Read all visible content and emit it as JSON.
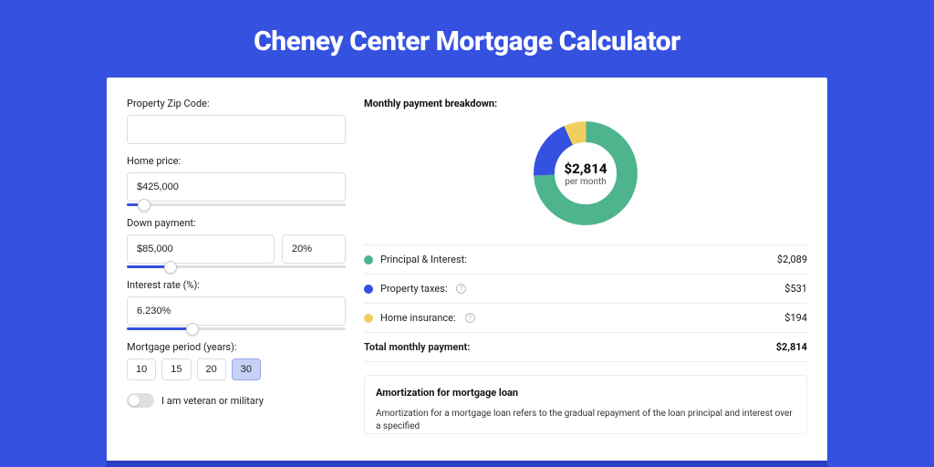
{
  "title": "Cheney Center Mortgage Calculator",
  "form": {
    "zip": {
      "label": "Property Zip Code:",
      "value": ""
    },
    "home_price": {
      "label": "Home price:",
      "value": "$425,000",
      "slider_percent": 8
    },
    "down_payment": {
      "label": "Down payment:",
      "value": "$85,000",
      "percent": "20%",
      "slider_percent": 20
    },
    "interest_rate": {
      "label": "Interest rate (%):",
      "value": "6.230%",
      "slider_percent": 30
    },
    "mortgage_period": {
      "label": "Mortgage period (years):",
      "options": [
        "10",
        "15",
        "20",
        "30"
      ],
      "selected": "30"
    },
    "veteran": {
      "label": "I am veteran or military",
      "checked": false
    }
  },
  "breakdown": {
    "title": "Monthly payment breakdown:",
    "center_amount": "$2,814",
    "center_sub": "per month",
    "items": [
      {
        "label": "Principal & Interest:",
        "value": "$2,089",
        "color": "#4eb48e",
        "help": false
      },
      {
        "label": "Property taxes:",
        "value": "$531",
        "color": "#3451e0",
        "help": true
      },
      {
        "label": "Home insurance:",
        "value": "$194",
        "color": "#f1cf5f",
        "help": true
      }
    ],
    "total_label": "Total monthly payment:",
    "total_value": "$2,814"
  },
  "chart_data": {
    "type": "pie",
    "title": "Monthly payment breakdown",
    "categories": [
      "Principal & Interest",
      "Property taxes",
      "Home insurance"
    ],
    "values": [
      2089,
      531,
      194
    ],
    "colors": [
      "#4eb48e",
      "#3451e0",
      "#f1cf5f"
    ],
    "center_label": "$2,814 per month"
  },
  "amortization": {
    "title": "Amortization for mortgage loan",
    "text": "Amortization for a mortgage loan refers to the gradual repayment of the loan principal and interest over a specified"
  }
}
